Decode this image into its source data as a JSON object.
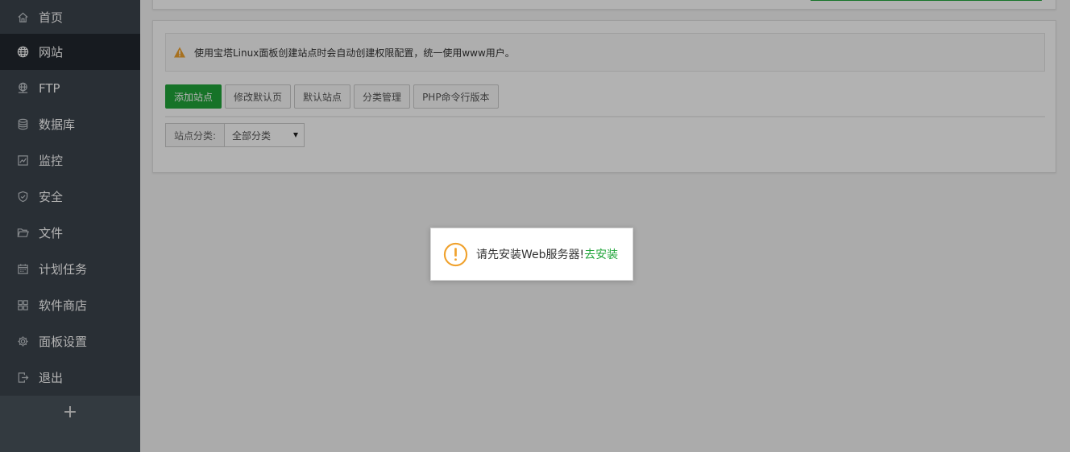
{
  "sidebar": {
    "items": [
      {
        "label": "首页",
        "icon": "home-icon"
      },
      {
        "label": "网站",
        "icon": "globe-icon",
        "active": true
      },
      {
        "label": "FTP",
        "icon": "ftp-icon"
      },
      {
        "label": "数据库",
        "icon": "database-icon"
      },
      {
        "label": "监控",
        "icon": "monitor-icon"
      },
      {
        "label": "安全",
        "icon": "shield-icon"
      },
      {
        "label": "文件",
        "icon": "folder-icon"
      },
      {
        "label": "计划任务",
        "icon": "calendar-icon"
      },
      {
        "label": "软件商店",
        "icon": "apps-grid-icon"
      },
      {
        "label": "面板设置",
        "icon": "gear-icon"
      },
      {
        "label": "退出",
        "icon": "logout-icon"
      }
    ],
    "add_label": "+"
  },
  "notice": {
    "text": "使用宝塔Linux面板创建站点时会自动创建权限配置，统一使用www用户。",
    "icon": "warning-triangle-icon"
  },
  "toolbar": {
    "add_site": "添加站点",
    "edit_default_page": "修改默认页",
    "default_site": "默认站点",
    "category_manage": "分类管理",
    "php_cli_version": "PHP命令行版本"
  },
  "filter": {
    "label": "站点分类:",
    "selected": "全部分类"
  },
  "dialog": {
    "message": "请先安装Web服务器!",
    "link": "去安装",
    "icon": "exclamation-circle-icon"
  },
  "colors": {
    "sidebar_bg": "#3c444d",
    "sidebar_active": "#22282e",
    "brand_green": "#20a53a",
    "warning_orange": "#f0a22e"
  }
}
